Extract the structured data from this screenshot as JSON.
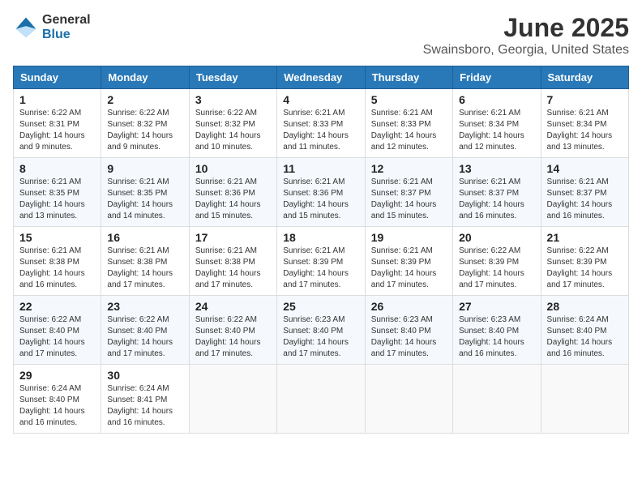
{
  "logo": {
    "general": "General",
    "blue": "Blue"
  },
  "title": "June 2025",
  "location": "Swainsboro, Georgia, United States",
  "weekdays": [
    "Sunday",
    "Monday",
    "Tuesday",
    "Wednesday",
    "Thursday",
    "Friday",
    "Saturday"
  ],
  "weeks": [
    [
      {
        "day": "1",
        "sunrise": "6:22 AM",
        "sunset": "8:31 PM",
        "daylight": "14 hours and 9 minutes."
      },
      {
        "day": "2",
        "sunrise": "6:22 AM",
        "sunset": "8:32 PM",
        "daylight": "14 hours and 9 minutes."
      },
      {
        "day": "3",
        "sunrise": "6:22 AM",
        "sunset": "8:32 PM",
        "daylight": "14 hours and 10 minutes."
      },
      {
        "day": "4",
        "sunrise": "6:21 AM",
        "sunset": "8:33 PM",
        "daylight": "14 hours and 11 minutes."
      },
      {
        "day": "5",
        "sunrise": "6:21 AM",
        "sunset": "8:33 PM",
        "daylight": "14 hours and 12 minutes."
      },
      {
        "day": "6",
        "sunrise": "6:21 AM",
        "sunset": "8:34 PM",
        "daylight": "14 hours and 12 minutes."
      },
      {
        "day": "7",
        "sunrise": "6:21 AM",
        "sunset": "8:34 PM",
        "daylight": "14 hours and 13 minutes."
      }
    ],
    [
      {
        "day": "8",
        "sunrise": "6:21 AM",
        "sunset": "8:35 PM",
        "daylight": "14 hours and 13 minutes."
      },
      {
        "day": "9",
        "sunrise": "6:21 AM",
        "sunset": "8:35 PM",
        "daylight": "14 hours and 14 minutes."
      },
      {
        "day": "10",
        "sunrise": "6:21 AM",
        "sunset": "8:36 PM",
        "daylight": "14 hours and 15 minutes."
      },
      {
        "day": "11",
        "sunrise": "6:21 AM",
        "sunset": "8:36 PM",
        "daylight": "14 hours and 15 minutes."
      },
      {
        "day": "12",
        "sunrise": "6:21 AM",
        "sunset": "8:37 PM",
        "daylight": "14 hours and 15 minutes."
      },
      {
        "day": "13",
        "sunrise": "6:21 AM",
        "sunset": "8:37 PM",
        "daylight": "14 hours and 16 minutes."
      },
      {
        "day": "14",
        "sunrise": "6:21 AM",
        "sunset": "8:37 PM",
        "daylight": "14 hours and 16 minutes."
      }
    ],
    [
      {
        "day": "15",
        "sunrise": "6:21 AM",
        "sunset": "8:38 PM",
        "daylight": "14 hours and 16 minutes."
      },
      {
        "day": "16",
        "sunrise": "6:21 AM",
        "sunset": "8:38 PM",
        "daylight": "14 hours and 17 minutes."
      },
      {
        "day": "17",
        "sunrise": "6:21 AM",
        "sunset": "8:38 PM",
        "daylight": "14 hours and 17 minutes."
      },
      {
        "day": "18",
        "sunrise": "6:21 AM",
        "sunset": "8:39 PM",
        "daylight": "14 hours and 17 minutes."
      },
      {
        "day": "19",
        "sunrise": "6:21 AM",
        "sunset": "8:39 PM",
        "daylight": "14 hours and 17 minutes."
      },
      {
        "day": "20",
        "sunrise": "6:22 AM",
        "sunset": "8:39 PM",
        "daylight": "14 hours and 17 minutes."
      },
      {
        "day": "21",
        "sunrise": "6:22 AM",
        "sunset": "8:39 PM",
        "daylight": "14 hours and 17 minutes."
      }
    ],
    [
      {
        "day": "22",
        "sunrise": "6:22 AM",
        "sunset": "8:40 PM",
        "daylight": "14 hours and 17 minutes."
      },
      {
        "day": "23",
        "sunrise": "6:22 AM",
        "sunset": "8:40 PM",
        "daylight": "14 hours and 17 minutes."
      },
      {
        "day": "24",
        "sunrise": "6:22 AM",
        "sunset": "8:40 PM",
        "daylight": "14 hours and 17 minutes."
      },
      {
        "day": "25",
        "sunrise": "6:23 AM",
        "sunset": "8:40 PM",
        "daylight": "14 hours and 17 minutes."
      },
      {
        "day": "26",
        "sunrise": "6:23 AM",
        "sunset": "8:40 PM",
        "daylight": "14 hours and 17 minutes."
      },
      {
        "day": "27",
        "sunrise": "6:23 AM",
        "sunset": "8:40 PM",
        "daylight": "14 hours and 16 minutes."
      },
      {
        "day": "28",
        "sunrise": "6:24 AM",
        "sunset": "8:40 PM",
        "daylight": "14 hours and 16 minutes."
      }
    ],
    [
      {
        "day": "29",
        "sunrise": "6:24 AM",
        "sunset": "8:40 PM",
        "daylight": "14 hours and 16 minutes."
      },
      {
        "day": "30",
        "sunrise": "6:24 AM",
        "sunset": "8:41 PM",
        "daylight": "14 hours and 16 minutes."
      },
      null,
      null,
      null,
      null,
      null
    ]
  ]
}
